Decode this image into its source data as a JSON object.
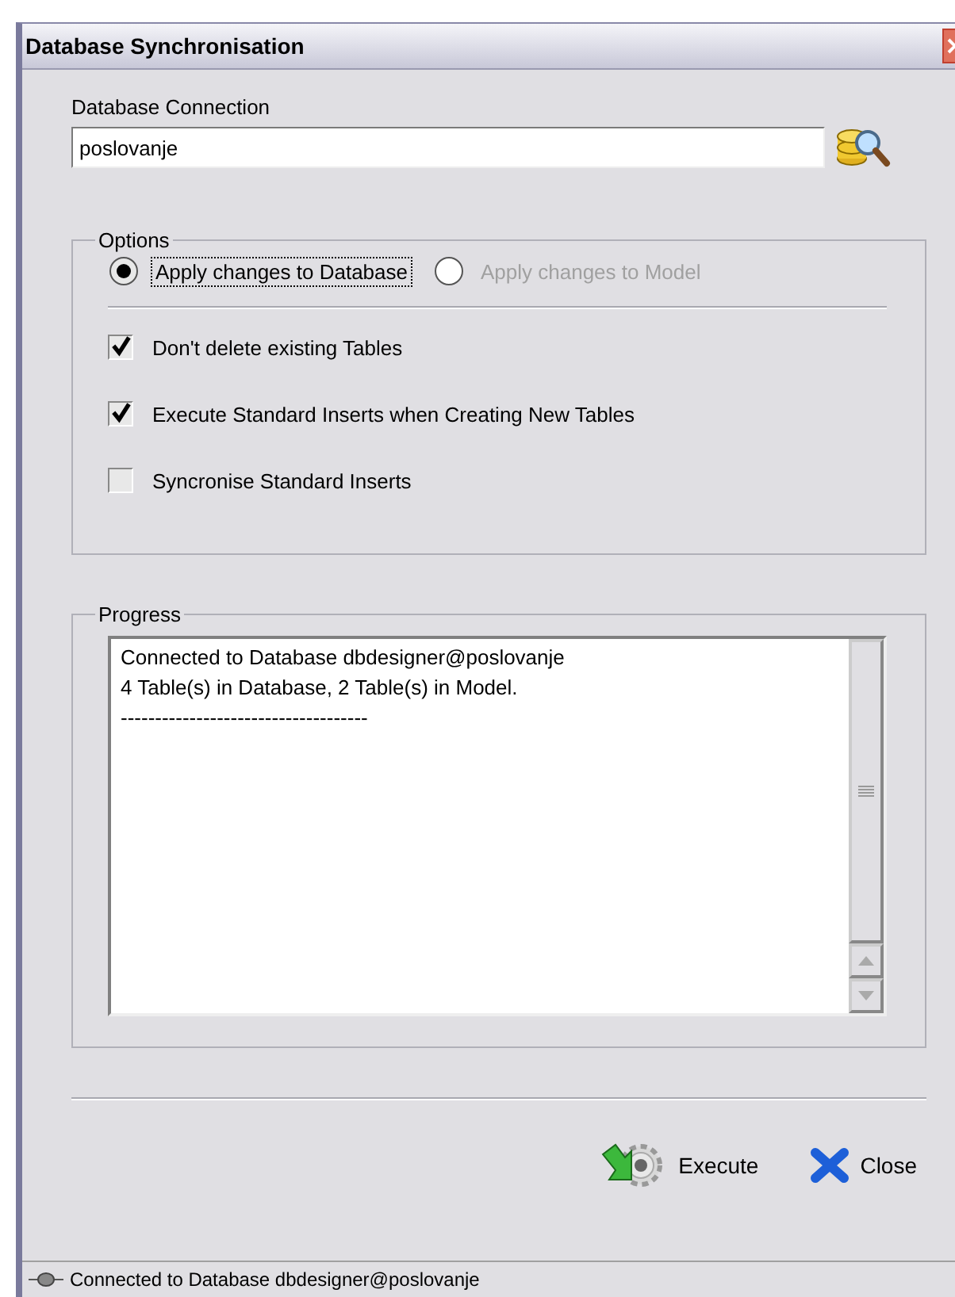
{
  "window": {
    "title": "Database Synchronisation"
  },
  "connection": {
    "label": "Database Connection",
    "value": "poslovanje"
  },
  "options": {
    "title": "Options",
    "radios": [
      {
        "label": "Apply changes to Database",
        "selected": true,
        "disabled": false
      },
      {
        "label": "Apply changes to Model",
        "selected": false,
        "disabled": true
      }
    ],
    "checkboxes": [
      {
        "label": "Don't delete existing Tables",
        "checked": true
      },
      {
        "label": "Execute Standard Inserts when Creating New Tables",
        "checked": true
      },
      {
        "label": "Syncronise Standard Inserts",
        "checked": false
      }
    ]
  },
  "progress": {
    "title": "Progress",
    "lines": [
      "Connected to Database dbdesigner@poslovanje",
      "4 Table(s) in Database, 2 Table(s) in Model.",
      "------------------------------------"
    ]
  },
  "buttons": [
    {
      "kind": "execute",
      "label": "Execute"
    },
    {
      "kind": "close",
      "label": "Close"
    }
  ],
  "status_bar": "Connected to Database dbdesigner@poslovanje"
}
